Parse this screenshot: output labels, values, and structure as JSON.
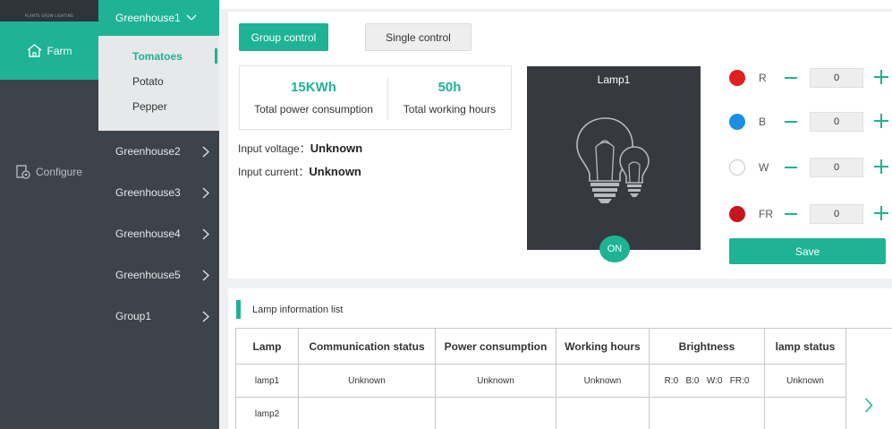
{
  "brand": {
    "logo_text": "PLANTS GROW LIGHTING"
  },
  "rail": {
    "items": [
      {
        "label": "Farm",
        "icon": "home-icon",
        "active": true
      },
      {
        "label": "Configure",
        "icon": "configure-icon",
        "active": false
      }
    ]
  },
  "nav": {
    "greenhouse1": {
      "label": "Greenhouse1",
      "expanded": true
    },
    "crops": [
      {
        "label": "Tomatoes",
        "active": true
      },
      {
        "label": "Potato",
        "active": false
      },
      {
        "label": "Pepper",
        "active": false
      }
    ],
    "groups": [
      {
        "label": "Greenhouse2"
      },
      {
        "label": "Greenhouse3"
      },
      {
        "label": "Greenhouse4"
      },
      {
        "label": "Greenhouse5"
      },
      {
        "label": "Group1"
      }
    ]
  },
  "controls": {
    "group_control": "Group control",
    "single_control": "Single control",
    "active_mode": "Group control"
  },
  "stats": {
    "power_value": "15KWh",
    "power_label": "Total power consumption",
    "hours_value": "50h",
    "hours_label": "Total working hours"
  },
  "inputs": {
    "voltage_label": "Input voltage：",
    "voltage_value": "Unknown",
    "current_label": "Input current：",
    "current_value": "Unknown"
  },
  "lamp": {
    "title": "Lamp1",
    "state": "ON"
  },
  "channels": [
    {
      "label": "R",
      "value": "0",
      "color": "#e0201c"
    },
    {
      "label": "B",
      "value": "0",
      "color": "#1a8fe0"
    },
    {
      "label": "W",
      "value": "0",
      "color": "#ffffff"
    },
    {
      "label": "FR",
      "value": "0",
      "color": "#c8141e"
    }
  ],
  "save_label": "Save",
  "list": {
    "title": "Lamp information list",
    "columns": [
      "Lamp",
      "Communication status",
      "Power consumption",
      "Working hours",
      "Brightness",
      "lamp status"
    ],
    "rows": [
      [
        "lamp1",
        "Unknown",
        "Unknown",
        "Unknown",
        "R:0   B:0   W:0   FR:0",
        "Unknown"
      ],
      [
        "lamp2",
        "",
        "",
        "",
        "",
        ""
      ]
    ]
  },
  "colors": {
    "accent": "#1db394",
    "rail": "#3d434b",
    "card": "#363a40"
  }
}
